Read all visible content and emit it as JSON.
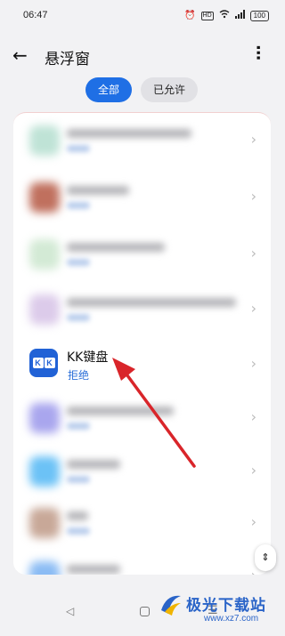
{
  "status_bar": {
    "time": "06:47",
    "battery": "100",
    "hd": "HD"
  },
  "header": {
    "title": "悬浮窗",
    "back_icon": "arrow-left-icon",
    "more_icon": "more-vertical-icon"
  },
  "tabs": [
    {
      "label": "全部",
      "active": true
    },
    {
      "label": "已允许",
      "active": false
    }
  ],
  "app_list": {
    "highlighted_app": {
      "name": "KK键盘",
      "status": "拒绝",
      "icon_text": "KK"
    }
  },
  "watermark": {
    "text": "极光下载站",
    "url": "www.xz7.com"
  },
  "colors": {
    "accent": "#1f6fe5",
    "arrow": "#d9252a"
  }
}
